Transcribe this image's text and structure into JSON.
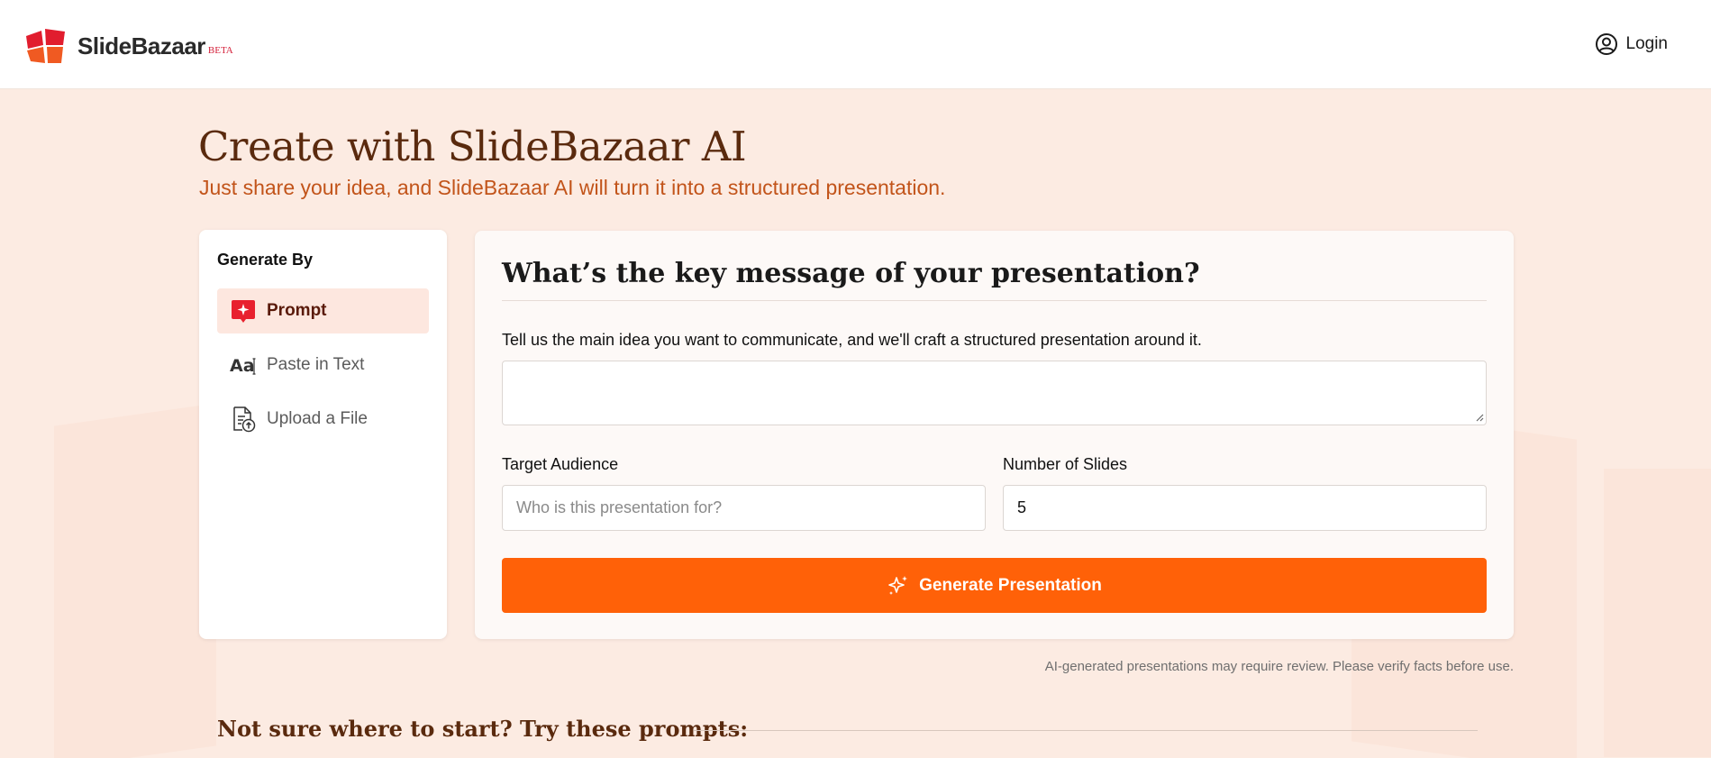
{
  "header": {
    "brand": "SlideBazaar",
    "beta": "BETA",
    "login_label": "Login"
  },
  "hero": {
    "title": "Create with SlideBazaar AI",
    "subtitle": "Just share your idea, and SlideBazaar AI will turn it into a structured presentation."
  },
  "sidebar": {
    "title": "Generate By",
    "items": [
      {
        "label": "Prompt",
        "icon": "sparkle-chat-icon",
        "active": true
      },
      {
        "label": "Paste in Text",
        "icon": "text-aa-icon",
        "active": false
      },
      {
        "label": "Upload a File",
        "icon": "file-upload-icon",
        "active": false
      }
    ]
  },
  "main": {
    "title": "What’s the key message of your presentation?",
    "description": "Tell us the main idea you want to communicate, and we'll craft a structured presentation around it.",
    "idea_value": "",
    "audience_label": "Target Audience",
    "audience_placeholder": "Who is this presentation for?",
    "slides_label": "Number of Slides",
    "slides_value": "5",
    "generate_label": "Generate Presentation"
  },
  "disclaimer": "AI-generated presentations may require review. Please verify facts before use.",
  "try_prompts_title": "Not sure where to start? Try these prompts:",
  "colors": {
    "accent": "#ff6108",
    "brand_red": "#e11d2e",
    "brand_orange": "#f05a22",
    "page_bg": "#fcebe2",
    "heading_brown": "#5a2a0e",
    "subtitle_orange": "#c2541a"
  }
}
